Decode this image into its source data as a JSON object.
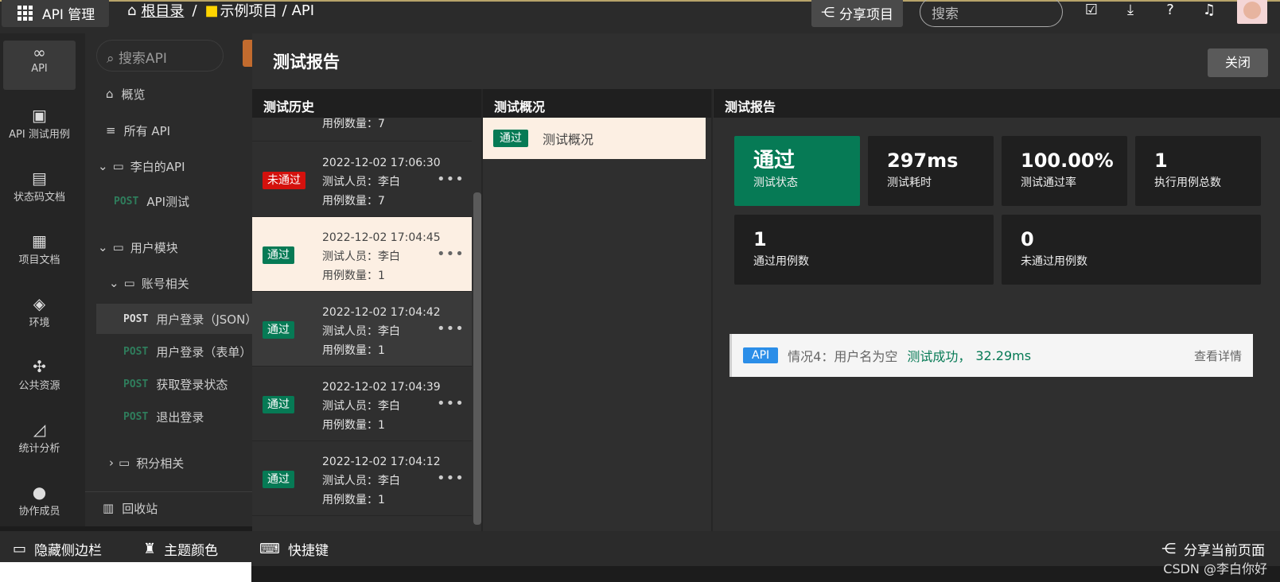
{
  "topbar": {
    "brand": "API 管理",
    "crumb_root": "根目录",
    "crumb_sep": "/",
    "crumb_project": "示例项目",
    "crumb_api": "API",
    "share_project": "分享项目",
    "search_placeholder": "搜索"
  },
  "rail": [
    {
      "label": "API",
      "icon": "link-icon"
    },
    {
      "label": "API 测试用例",
      "icon": "clipboard-check-icon"
    },
    {
      "label": "状态码文档",
      "icon": "document-icon"
    },
    {
      "label": "项目文档",
      "icon": "book-icon"
    },
    {
      "label": "环境",
      "icon": "cube-icon"
    },
    {
      "label": "公共资源",
      "icon": "puzzle-icon"
    },
    {
      "label": "统计分析",
      "icon": "chart-icon"
    },
    {
      "label": "协作成员",
      "icon": "user-icon"
    }
  ],
  "sidebar": {
    "search_placeholder": "搜索API",
    "overview": "概览",
    "all_api": "所有 API",
    "folder_libai": "李白的API",
    "libai_api_method": "POST",
    "libai_api_name": "API测试",
    "folder_user": "用户模块",
    "folder_account": "账号相关",
    "apis": [
      {
        "method": "POST",
        "name": "用户登录（JSON）"
      },
      {
        "method": "POST",
        "name": "用户登录（表单）"
      },
      {
        "method": "POST",
        "name": "获取登录状态"
      },
      {
        "method": "POST",
        "name": "退出登录"
      }
    ],
    "folder_points": "积分相关",
    "trash": "回收站"
  },
  "bottombar": {
    "hide_sidebar": "隐藏侧边栏",
    "theme": "主题颜色",
    "shortcuts": "快捷键",
    "share_page": "分享当前页面",
    "watermark": "CSDN @李白你好"
  },
  "modal": {
    "title": "测试报告",
    "close": "关闭",
    "col_history": "测试历史",
    "col_overview": "测试概况",
    "col_report": "测试报告",
    "history_partial_count": "用例数量：7",
    "history": [
      {
        "status": "未通过",
        "time": "2022-12-02 17:06:30",
        "tester": "测试人员：李白",
        "count": "用例数量：7"
      },
      {
        "status": "通过",
        "time": "2022-12-02 17:04:45",
        "tester": "测试人员：李白",
        "count": "用例数量：1"
      },
      {
        "status": "通过",
        "time": "2022-12-02 17:04:42",
        "tester": "测试人员：李白",
        "count": "用例数量：1"
      },
      {
        "status": "通过",
        "time": "2022-12-02 17:04:39",
        "tester": "测试人员：李白",
        "count": "用例数量：1"
      },
      {
        "status": "通过",
        "time": "2022-12-02 17:04:12",
        "tester": "测试人员：李白",
        "count": "用例数量：1"
      }
    ],
    "more_icon": "•••",
    "overview_badge": "通过",
    "overview_label": "测试概况",
    "stats": [
      {
        "value": "通过",
        "label": "测试状态"
      },
      {
        "value": "297ms",
        "label": "测试耗时"
      },
      {
        "value": "100.00%",
        "label": "测试通过率"
      },
      {
        "value": "1",
        "label": "执行用例总数"
      },
      {
        "value": "1",
        "label": "通过用例数"
      },
      {
        "value": "0",
        "label": "未通过用例数"
      }
    ],
    "result": {
      "tag": "API",
      "case": "情况4：用户名为空",
      "status": "测试成功，",
      "duration": "32.29ms",
      "detail": "查看详情"
    }
  },
  "colors": {
    "pass": "#067a55",
    "fail": "#d4110d",
    "api_tag": "#2b8ee8",
    "selected_row": "#fcefe3"
  }
}
